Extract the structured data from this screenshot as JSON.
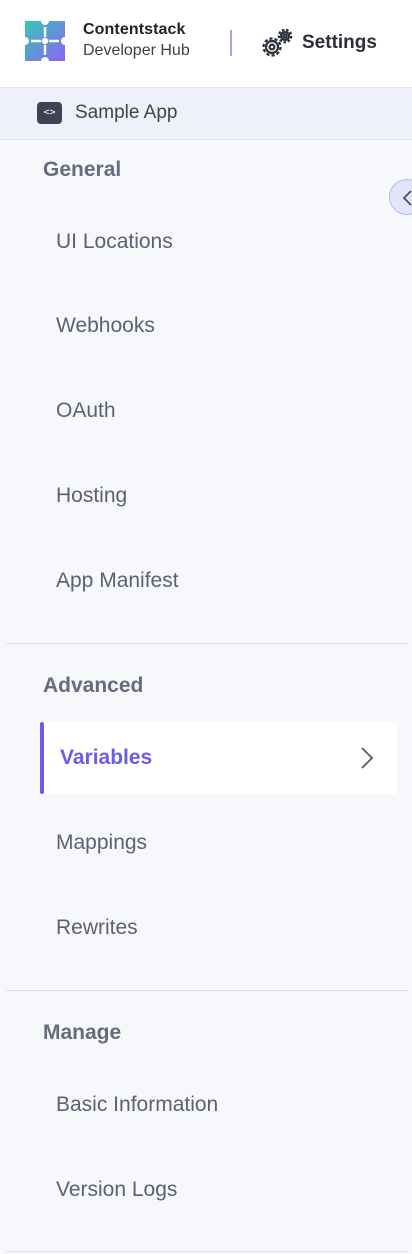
{
  "header": {
    "brand_name": "Contentstack",
    "brand_sub": "Developer Hub",
    "settings_label": "Settings"
  },
  "app": {
    "name": "Sample App",
    "icon_glyph": "<>"
  },
  "sections": {
    "general": {
      "title": "General",
      "items": [
        "UI Locations",
        "Webhooks",
        "OAuth",
        "Hosting",
        "App Manifest"
      ]
    },
    "advanced": {
      "title": "Advanced",
      "active_item": "Variables",
      "items": [
        "Mappings",
        "Rewrites"
      ]
    },
    "manage": {
      "title": "Manage",
      "items": [
        "Basic Information",
        "Version Logs"
      ]
    }
  },
  "icons": {
    "logo": "contentstack-puzzle-logo-icon",
    "settings": "gears-icon",
    "collapse": "chevron-left-icon",
    "active_chevron": "chevron-right-icon"
  },
  "colors": {
    "accent": "#6c5ce7",
    "logo_teal": "#2ec4b6",
    "logo_purple": "#7b61ff"
  }
}
